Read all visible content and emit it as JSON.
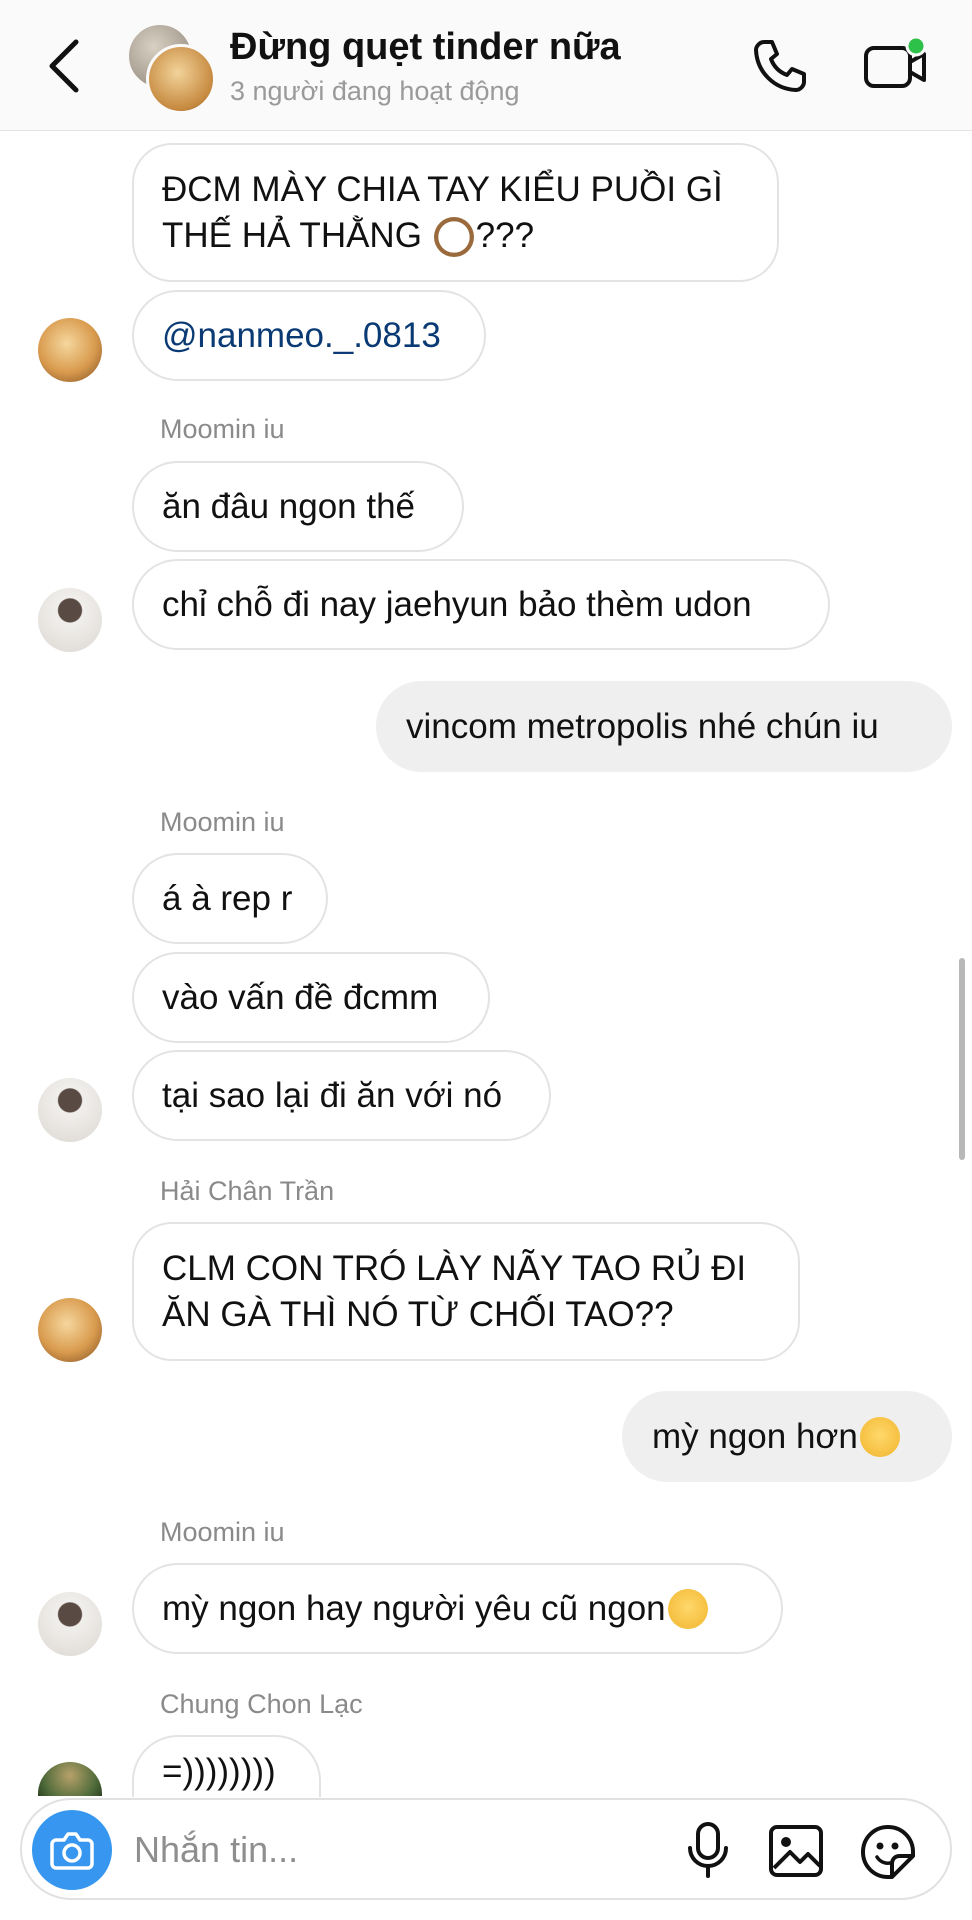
{
  "header": {
    "title": "Đừng quẹt tinder nữa",
    "subtitle": "3 người đang hoạt động",
    "back_icon": "chevron-left-icon",
    "call_icon": "phone-icon",
    "video_icon": "video-camera-icon",
    "online_color": "#2ec14a"
  },
  "messages": [
    {
      "text": "ĐCM MÀY CHIA TAY KIỂU PUỒI GÌ",
      "text2": "THẾ HẢ THẰNG",
      "text3": "???"
    },
    {
      "text": "@nanmeo._.0813"
    },
    {
      "sender": "Moomin iu"
    },
    {
      "text": "ăn đâu ngon thế"
    },
    {
      "text": "chỉ chỗ đi nay jaehyun bảo thèm udon"
    },
    {
      "text": "vincom metropolis nhé chún iu"
    },
    {
      "sender": "Moomin iu"
    },
    {
      "text": "á à rep r"
    },
    {
      "text": "vào vấn đề đcmm"
    },
    {
      "text": "tại sao lại đi ăn với nó"
    },
    {
      "sender": "Hải Chân Trần"
    },
    {
      "text": "CLM CON TRÓ LÀY NÃY TAO RỦ ĐI",
      "text2": "ĂN GÀ THÌ NÓ TỪ CHỐI TAO??"
    },
    {
      "text": "mỳ ngon hơn"
    },
    {
      "sender": "Moomin iu"
    },
    {
      "text": "mỳ ngon hay người yêu cũ ngon"
    },
    {
      "sender": "Chung Chon Lạc"
    },
    {
      "text": "=))))))))"
    }
  ],
  "composer": {
    "placeholder": "Nhắn tin...",
    "camera_icon": "camera-icon",
    "mic_icon": "microphone-icon",
    "gallery_icon": "gallery-icon",
    "sticker_icon": "sticker-icon",
    "accent": "#3797f0"
  }
}
